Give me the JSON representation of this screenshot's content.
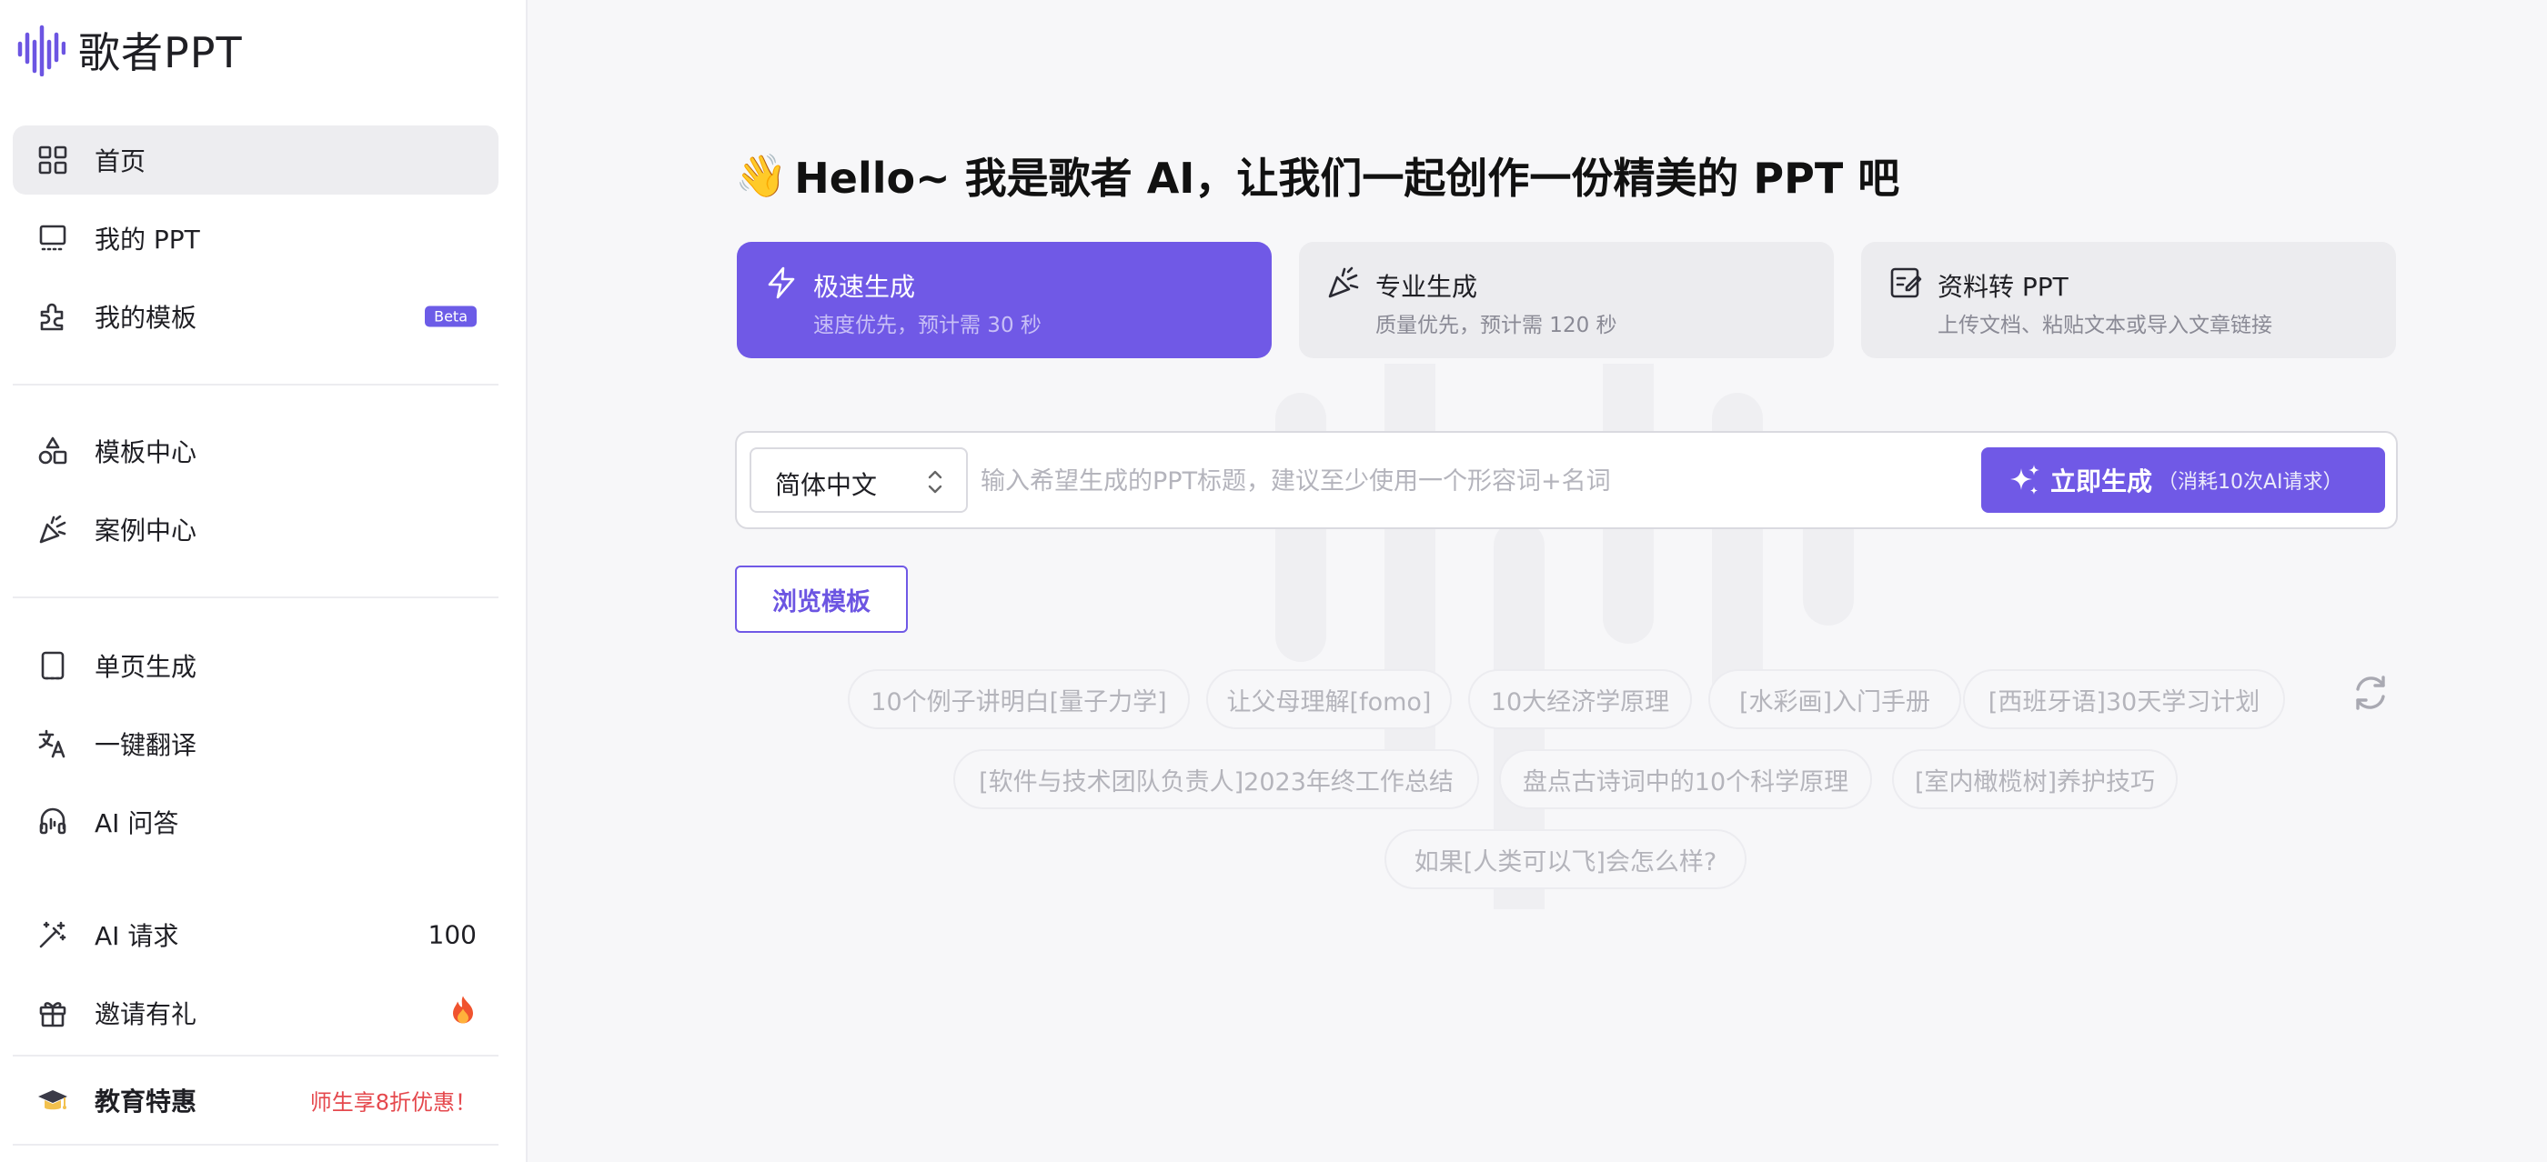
{
  "app": {
    "name": "歌者PPT"
  },
  "sidebar": {
    "items": [
      {
        "label": "首页",
        "icon": "grid-icon",
        "active": true
      },
      {
        "label": "我的 PPT",
        "icon": "monitor-icon"
      },
      {
        "label": "我的模板",
        "icon": "puzzle-icon",
        "badge": "Beta"
      },
      {
        "label": "模板中心",
        "icon": "shapes-icon"
      },
      {
        "label": "案例中心",
        "icon": "party-popper-icon"
      },
      {
        "label": "单页生成",
        "icon": "page-frame-icon"
      },
      {
        "label": "一键翻译",
        "icon": "translate-icon"
      },
      {
        "label": "AI 问答",
        "icon": "headset-icon"
      },
      {
        "label": "AI 请求",
        "icon": "magic-wand-icon",
        "value": "100"
      },
      {
        "label": "邀请有礼",
        "icon": "gift-icon",
        "badge_icon": "fire-icon"
      },
      {
        "label": "教育特惠",
        "icon": "graduation-cap-icon",
        "note": "师生享8折优惠！"
      }
    ]
  },
  "main": {
    "headline": "Hello~ 我是歌者 AI，让我们一起创作一份精美的 PPT 吧",
    "headline_emoji": "👋",
    "modes": [
      {
        "title": "极速生成",
        "subtitle": "速度优先，预计需 30 秒",
        "icon": "zap-icon",
        "active": true
      },
      {
        "title": "专业生成",
        "subtitle": "质量优先，预计需 120 秒",
        "icon": "party-popper-icon"
      },
      {
        "title": "资料转 PPT",
        "subtitle": "上传文档、粘贴文本或导入文章链接",
        "icon": "edit-doc-icon"
      }
    ],
    "language": "简体中文",
    "prompt_placeholder": "输入希望生成的PPT标题，建议至少使用一个形容词+名词",
    "generate_label": "立即生成",
    "generate_note": "（消耗10次AI请求）",
    "browse_label": "浏览模板",
    "suggestions": [
      "10个例子讲明白[量子力学]",
      "让父母理解[fomo]",
      "10大经济学原理",
      "[水彩画]入门手册",
      "[西班牙语]30天学习计划",
      "[软件与技术团队负责人]2023年终工作总结",
      "盘点古诗词中的10个科学原理",
      "[室内橄榄树]养护技巧",
      "如果[人类可以飞]会怎么样?"
    ]
  },
  "colors": {
    "accent": "#7059e6",
    "danger": "#e5484d",
    "beta": "#6c5ce7"
  }
}
